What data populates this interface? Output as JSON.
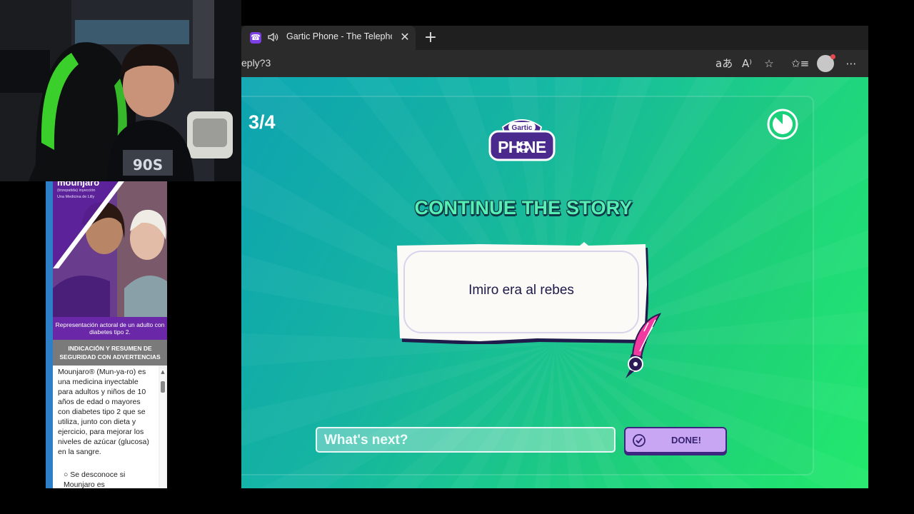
{
  "browser": {
    "tab_title": "Gartic Phone - The Telephone Game",
    "tab_favicon": "phone-icon",
    "tab_close": "✕",
    "new_tab": "+",
    "url_fragment": "eply?3",
    "toolbar_icons": [
      "read-aloud-translate-icon",
      "read-aloud-icon",
      "favorite-star-icon",
      "favorites-list-icon",
      "profile-avatar-icon",
      "more-menu-icon"
    ]
  },
  "game": {
    "round": "3/4",
    "logo_top": "Gartic",
    "logo_bottom": "PHONE",
    "heading": "CONTINUE THE STORY",
    "story_text": "Imiro era al rebes",
    "input_placeholder": "What's next?",
    "done_label": "DONE!",
    "colors": {
      "heading": "#56f0b5",
      "done_bg": "#c8a6f4",
      "done_border": "#3c2680",
      "bg_start": "#0fa7b4",
      "bg_end": "#22e86c"
    }
  },
  "ad": {
    "brand": "mounjaro",
    "brand_sub1": "(tirzepatida) inyección",
    "brand_sub2": "Una Medicina de Lilly",
    "image_caption": "Representación actoral de un adulto con diabetes tipo 2.",
    "section_header": "INDICACIÓN Y RESUMEN DE SEGURIDAD CON ADVERTENCIAS",
    "body_text": "Mounjaro® (Mun-ya-ro) es una medicina inyectable para adultos y niños de 10 años de edad o mayores con diabetes tipo 2 que se utiliza, junto con dieta y ejercicio, para mejorar los niveles de azúcar (glucosa) en la sangre.",
    "bullet_text": "Se desconoce si Mounjaro es"
  }
}
